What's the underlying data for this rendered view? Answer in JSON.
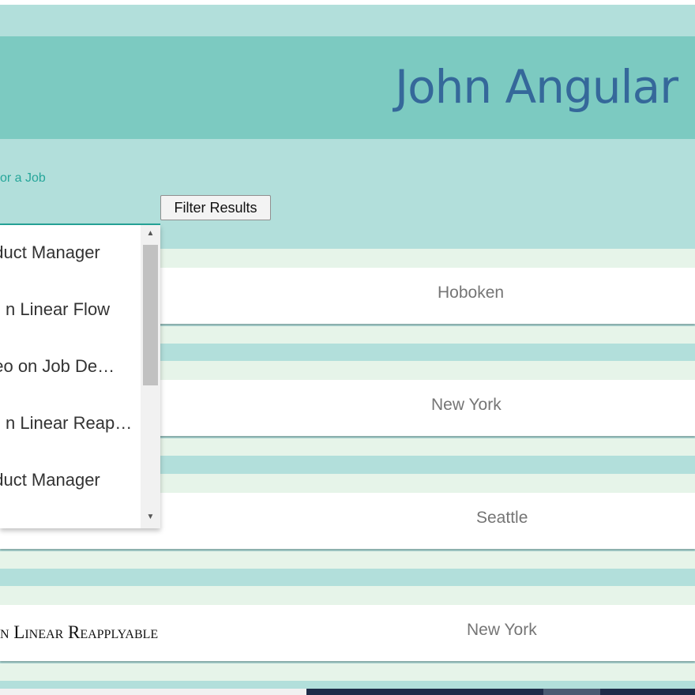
{
  "header": {
    "title": "John Angular"
  },
  "search": {
    "label": "or a Job",
    "filter_button": "Filter Results"
  },
  "results": [
    {
      "location": "Hoboken"
    },
    {
      "location": "New York"
    },
    {
      "location": "Seattle"
    },
    {
      "title": "n Linear Reapplyable",
      "location": "New York"
    }
  ],
  "dropdown": {
    "items": [
      "oduct Manager",
      "n Linear Flow",
      "deo on Job De…",
      "n Linear Reap…",
      "oduct Manager"
    ]
  },
  "colors": {
    "background": "#b2dfdb",
    "header": "#7ccac1",
    "title": "#35689a",
    "accent": "#26a69a",
    "band": "#e6f4e9"
  }
}
